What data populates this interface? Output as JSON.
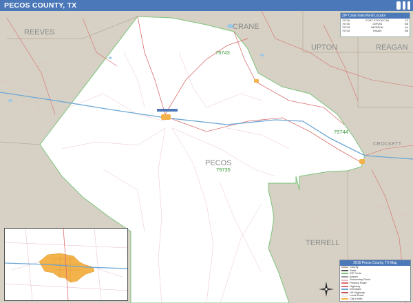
{
  "title": "PECOS COUNTY, TX",
  "brand": {
    "logo": "",
    "badges": [
      "",
      ""
    ]
  },
  "counties": {
    "reeves": "REEVES",
    "crane": "CRANE",
    "upton": "UPTON",
    "reagan": "REAGAN",
    "crockett": "CROCKETT",
    "terrell": "TERRELL",
    "pecos": "PECOS"
  },
  "zips": {
    "z1": "79743",
    "z2": "79744",
    "z3": "79735"
  },
  "zip_table": {
    "header": "ZIP Code Index/Grid Locator",
    "rows": [
      {
        "zip": "79735",
        "city": "FORT STOCKTON",
        "grid": "C3"
      },
      {
        "zip": "79740",
        "city": "GIRVIN",
        "grid": "B5"
      },
      {
        "zip": "79743",
        "city": "IMPERIAL",
        "grid": "A4"
      },
      {
        "zip": "79744",
        "city": "IRAAN",
        "grid": "B6"
      }
    ]
  },
  "legend": {
    "header": "2016 Pecos County, TX Map",
    "rows": [
      "County",
      "State",
      "ZIP Code",
      "Airport",
      "Secondary Road",
      "Primary Road",
      "Highway",
      "Interstate",
      "US Highway",
      "Local Road",
      "City Limits",
      "Water"
    ]
  },
  "colors": {
    "title_bar": "#4b78b8",
    "surrounding_land": "#d6d1c4",
    "county_fill": "#ffffff",
    "interstate": "#6aa6d6",
    "highway": "#d96b6b",
    "local_road": "#e6b8c8",
    "zip_boundary": "#7cc47c",
    "city_fill": "#f3b24a",
    "water": "#9ec7e6"
  },
  "icons": {
    "compass": "compass-rose-icon"
  }
}
